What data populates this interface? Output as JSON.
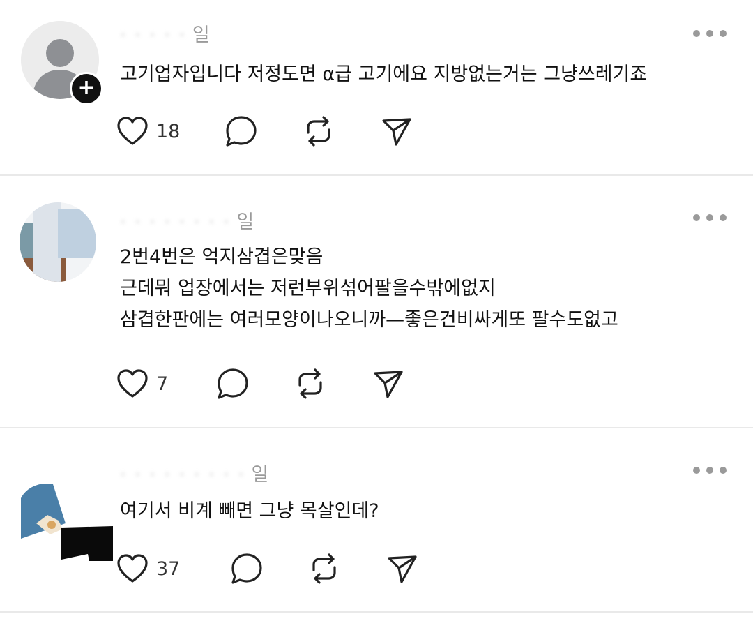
{
  "posts": [
    {
      "time_suffix": "일",
      "lines": [
        "고기업자입니다  저정도면 α급 고기에요  지방없는거는 그냥쓰레기죠"
      ],
      "likes": "18",
      "follow_label": "+"
    },
    {
      "time_suffix": "일",
      "lines": [
        "2번4번은 억지삼겹은맞음",
        "근데뭐 업장에서는  저런부위섞어팔을수밖에없지",
        "삼겹한판에는 여러모양이나오니까—좋은건비싸게또 팔수도없고"
      ],
      "likes": "7"
    },
    {
      "time_suffix": "일",
      "lines": [
        "여기서 비계 빼면 그냥 목살인데?"
      ],
      "likes": "37"
    }
  ],
  "icons": {
    "like": "heart-icon",
    "reply": "comment-bubble-icon",
    "repost": "repost-icon",
    "share": "send-icon",
    "more": "more-dots-icon"
  },
  "colors": {
    "background": "#ffffff",
    "text": "#111111",
    "meta": "#9a9a9a",
    "divider": "#e9e9e9"
  }
}
